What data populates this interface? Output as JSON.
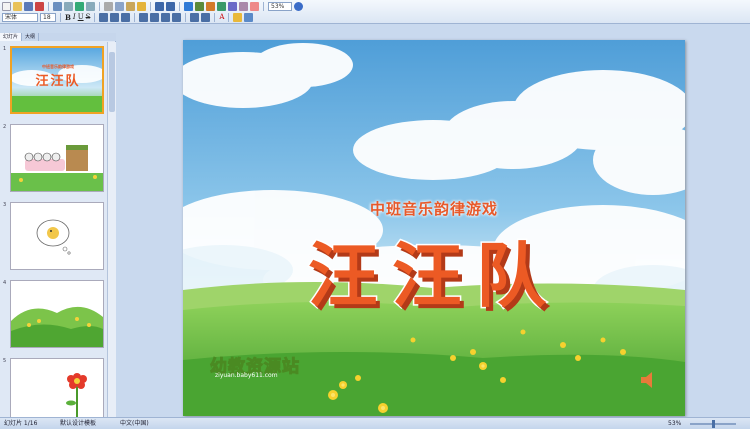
{
  "toolbar": {
    "font_name": "宋体",
    "font_size": "18",
    "bold": "B",
    "italic": "I",
    "underline": "U",
    "strike": "S",
    "shadow": "A"
  },
  "panel": {
    "tabs": [
      "幻灯片",
      "大纲"
    ],
    "slides": [
      {
        "number": "1",
        "title": "汪汪队",
        "subtitle": "中班音乐韵律游戏"
      },
      {
        "number": "2"
      },
      {
        "number": "3"
      },
      {
        "number": "4"
      },
      {
        "number": "5"
      }
    ]
  },
  "slide": {
    "subtitle": "中班音乐韵律游戏",
    "title": "汪汪队",
    "logo": "幼教资源站",
    "url": "ziyuan.baby611.com"
  },
  "status": {
    "slide_info": "幻灯片 1/16",
    "theme": "默认设计模板",
    "language": "中文(中国)",
    "zoom": "53%"
  },
  "colors": {
    "accent": "#ec5a24",
    "sky": "#6fb3e3",
    "grass": "#5cb83a"
  }
}
